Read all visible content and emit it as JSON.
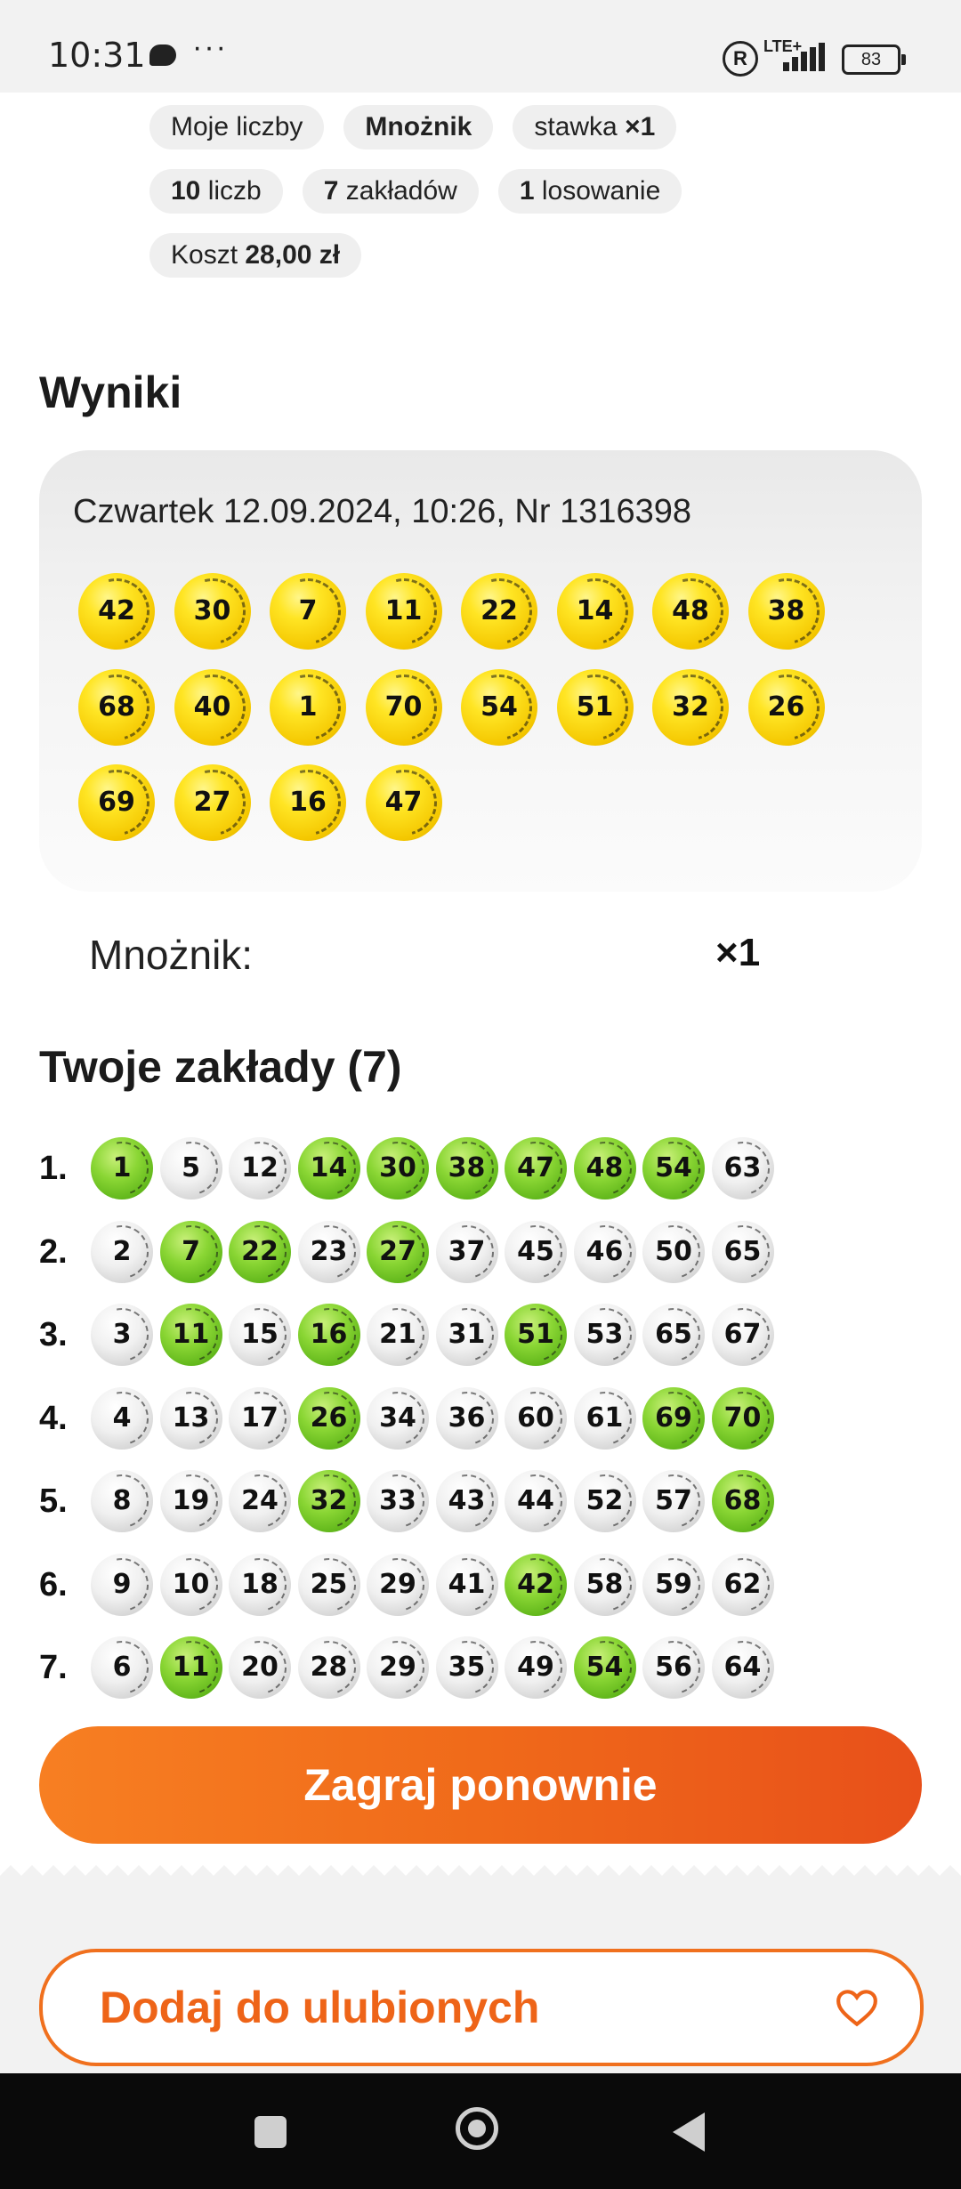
{
  "status_bar": {
    "time": "10:31",
    "dots": "···",
    "reg": "R",
    "network": "LTE+",
    "battery": "83"
  },
  "chips": [
    [
      {
        "text": "Moje liczby"
      },
      {
        "bold": "Mnożnik"
      },
      {
        "text": "stawka ",
        "bold_after": "×1"
      }
    ],
    [
      {
        "bold": "10",
        "text_after": " liczb"
      },
      {
        "bold": "7",
        "text_after": " zakładów"
      },
      {
        "bold": "1",
        "text_after": " losowanie"
      }
    ],
    [
      {
        "text": "Koszt ",
        "bold_after": "28,00 zł"
      }
    ]
  ],
  "results": {
    "title": "Wyniki",
    "draw_info": "Czwartek 12.09.2024, 10:26, Nr 1316398",
    "numbers": [
      "42",
      "30",
      "7",
      "11",
      "22",
      "14",
      "48",
      "38",
      "68",
      "40",
      "1",
      "70",
      "54",
      "51",
      "32",
      "26",
      "69",
      "27",
      "16",
      "47"
    ]
  },
  "multiplier": {
    "label": "Mnożnik:",
    "value": "×1"
  },
  "bets": {
    "title": "Twoje zakłady (7)",
    "rows": [
      {
        "label": "1.",
        "balls": [
          {
            "n": "1",
            "hit": true
          },
          {
            "n": "5",
            "hit": false
          },
          {
            "n": "12",
            "hit": false
          },
          {
            "n": "14",
            "hit": true
          },
          {
            "n": "30",
            "hit": true
          },
          {
            "n": "38",
            "hit": true
          },
          {
            "n": "47",
            "hit": true
          },
          {
            "n": "48",
            "hit": true
          },
          {
            "n": "54",
            "hit": true
          },
          {
            "n": "63",
            "hit": false
          }
        ]
      },
      {
        "label": "2.",
        "balls": [
          {
            "n": "2",
            "hit": false
          },
          {
            "n": "7",
            "hit": true
          },
          {
            "n": "22",
            "hit": true
          },
          {
            "n": "23",
            "hit": false
          },
          {
            "n": "27",
            "hit": true
          },
          {
            "n": "37",
            "hit": false
          },
          {
            "n": "45",
            "hit": false
          },
          {
            "n": "46",
            "hit": false
          },
          {
            "n": "50",
            "hit": false
          },
          {
            "n": "65",
            "hit": false
          }
        ]
      },
      {
        "label": "3.",
        "balls": [
          {
            "n": "3",
            "hit": false
          },
          {
            "n": "11",
            "hit": true
          },
          {
            "n": "15",
            "hit": false
          },
          {
            "n": "16",
            "hit": true
          },
          {
            "n": "21",
            "hit": false
          },
          {
            "n": "31",
            "hit": false
          },
          {
            "n": "51",
            "hit": true
          },
          {
            "n": "53",
            "hit": false
          },
          {
            "n": "65",
            "hit": false
          },
          {
            "n": "67",
            "hit": false
          }
        ]
      },
      {
        "label": "4.",
        "balls": [
          {
            "n": "4",
            "hit": false
          },
          {
            "n": "13",
            "hit": false
          },
          {
            "n": "17",
            "hit": false
          },
          {
            "n": "26",
            "hit": true
          },
          {
            "n": "34",
            "hit": false
          },
          {
            "n": "36",
            "hit": false
          },
          {
            "n": "60",
            "hit": false
          },
          {
            "n": "61",
            "hit": false
          },
          {
            "n": "69",
            "hit": true
          },
          {
            "n": "70",
            "hit": true
          }
        ]
      },
      {
        "label": "5.",
        "balls": [
          {
            "n": "8",
            "hit": false
          },
          {
            "n": "19",
            "hit": false
          },
          {
            "n": "24",
            "hit": false
          },
          {
            "n": "32",
            "hit": true
          },
          {
            "n": "33",
            "hit": false
          },
          {
            "n": "43",
            "hit": false
          },
          {
            "n": "44",
            "hit": false
          },
          {
            "n": "52",
            "hit": false
          },
          {
            "n": "57",
            "hit": false
          },
          {
            "n": "68",
            "hit": true
          }
        ]
      },
      {
        "label": "6.",
        "balls": [
          {
            "n": "9",
            "hit": false
          },
          {
            "n": "10",
            "hit": false
          },
          {
            "n": "18",
            "hit": false
          },
          {
            "n": "25",
            "hit": false
          },
          {
            "n": "29",
            "hit": false
          },
          {
            "n": "41",
            "hit": false
          },
          {
            "n": "42",
            "hit": true
          },
          {
            "n": "58",
            "hit": false
          },
          {
            "n": "59",
            "hit": false
          },
          {
            "n": "62",
            "hit": false
          }
        ]
      },
      {
        "label": "7.",
        "balls": [
          {
            "n": "6",
            "hit": false
          },
          {
            "n": "11",
            "hit": true
          },
          {
            "n": "20",
            "hit": false
          },
          {
            "n": "28",
            "hit": false
          },
          {
            "n": "29",
            "hit": false
          },
          {
            "n": "35",
            "hit": false
          },
          {
            "n": "49",
            "hit": false
          },
          {
            "n": "54",
            "hit": true
          },
          {
            "n": "56",
            "hit": false
          },
          {
            "n": "64",
            "hit": false
          }
        ]
      }
    ]
  },
  "buttons": {
    "play_again": "Zagraj ponownie",
    "add_favorite": "Dodaj do ulubionych",
    "favorite_icon": "heart-icon"
  },
  "colors": {
    "accent_orange": "#f06a1a",
    "hit_green": "#7ccb2a",
    "draw_yellow": "#ffe524"
  },
  "nav": {
    "recent_icon": "square-icon",
    "home_icon": "circle-icon",
    "back_icon": "triangle-back-icon"
  }
}
